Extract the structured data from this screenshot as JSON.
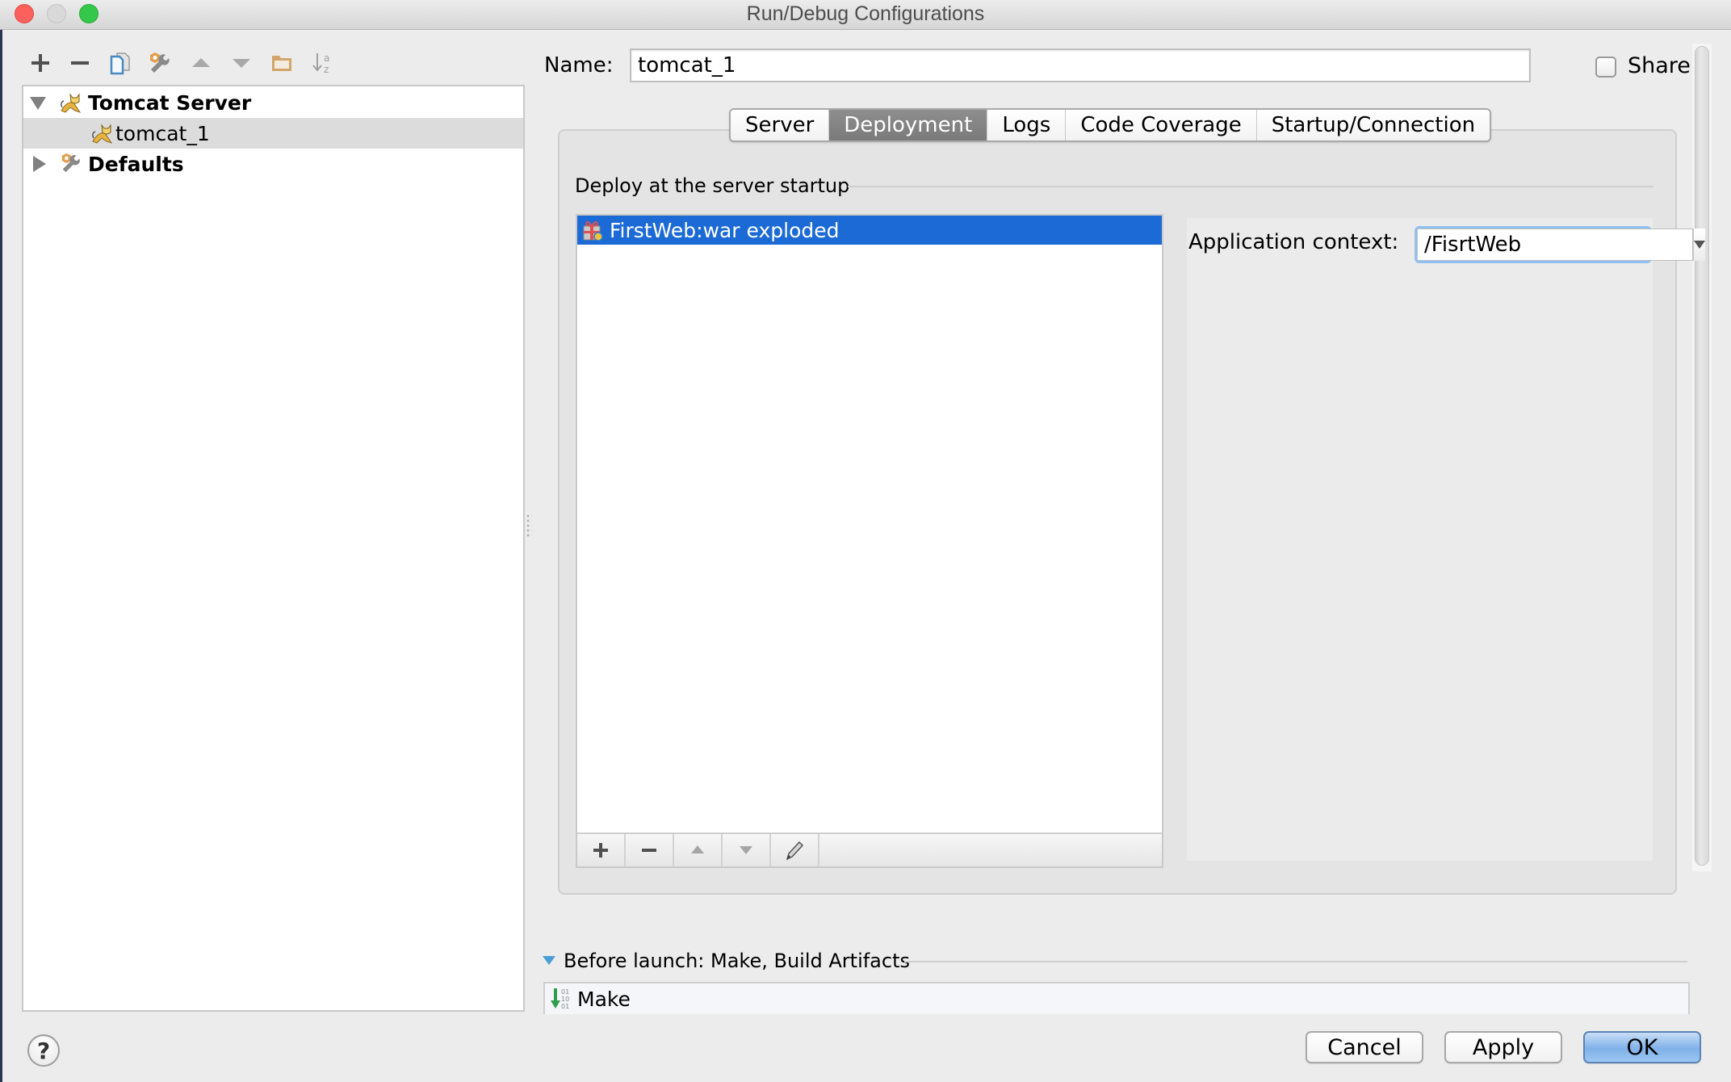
{
  "window": {
    "title": "Run/Debug Configurations"
  },
  "left_toolbar": {
    "icons": [
      "add-icon",
      "remove-icon",
      "copy-icon",
      "edit-defaults-icon",
      "move-up-icon",
      "move-down-icon",
      "folder-icon",
      "sort-az-icon"
    ]
  },
  "tree": {
    "items": [
      {
        "label": "Tomcat Server",
        "level": 0,
        "expanded": true,
        "bold": true,
        "icon": "tomcat-icon"
      },
      {
        "label": "tomcat_1",
        "level": 1,
        "selected": true,
        "icon": "tomcat-icon"
      },
      {
        "label": "Defaults",
        "level": 0,
        "expanded": false,
        "bold": true,
        "icon": "wrench-icon"
      }
    ]
  },
  "config": {
    "name_label": "Name:",
    "name_value": "tomcat_1",
    "share_label": "Share",
    "share_checked": false
  },
  "tabs": [
    {
      "label": "Server",
      "active": false
    },
    {
      "label": "Deployment",
      "active": true
    },
    {
      "label": "Logs",
      "active": false
    },
    {
      "label": "Code Coverage",
      "active": false
    },
    {
      "label": "Startup/Connection",
      "active": false
    }
  ],
  "deployment": {
    "heading": "Deploy at the server startup",
    "artifacts": [
      {
        "label": "FirstWeb:war exploded",
        "selected": true
      }
    ],
    "list_toolbar": [
      "add-icon",
      "remove-icon",
      "move-up-icon",
      "move-down-icon",
      "edit-icon"
    ],
    "context_label": "Application context:",
    "context_value": "/FisrtWeb"
  },
  "before_launch": {
    "heading": "Before launch: Make, Build Artifacts",
    "tasks": [
      {
        "label": "Make",
        "icon": "make-icon"
      }
    ]
  },
  "buttons": {
    "help": "?",
    "cancel": "Cancel",
    "apply": "Apply",
    "ok": "OK"
  },
  "colors": {
    "selection": "#1b6ad6",
    "focus_ring": "#8fc0f4",
    "active_tab": "#808080"
  }
}
